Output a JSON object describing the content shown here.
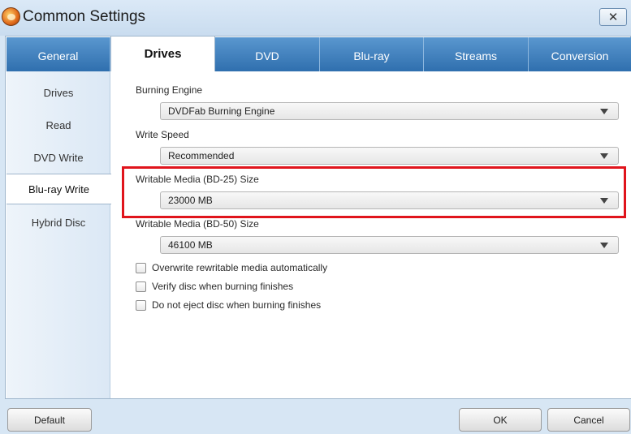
{
  "window": {
    "title": "Common Settings",
    "close_glyph": "✕"
  },
  "tabs": [
    "General",
    "Drives",
    "DVD",
    "Blu-ray",
    "Streams",
    "Conversion"
  ],
  "active_tab": "Drives",
  "nav": [
    "Drives",
    "Read",
    "DVD Write",
    "Blu-ray Write",
    "Hybrid Disc"
  ],
  "active_nav": "Blu-ray Write",
  "settings": {
    "burning_engine": {
      "label": "Burning Engine",
      "value": "DVDFab Burning Engine"
    },
    "write_speed": {
      "label": "Write Speed",
      "value": "Recommended"
    },
    "bd25_size": {
      "label": "Writable Media (BD-25) Size",
      "value": "23000 MB"
    },
    "bd50_size": {
      "label": "Writable Media (BD-50) Size",
      "value": "46100 MB"
    }
  },
  "checkboxes": [
    {
      "label": "Overwrite rewritable media automatically",
      "checked": false
    },
    {
      "label": "Verify disc when burning finishes",
      "checked": false
    },
    {
      "label": "Do not eject disc when burning finishes",
      "checked": false
    }
  ],
  "buttons": {
    "default": "Default",
    "ok": "OK",
    "cancel": "Cancel"
  },
  "colors": {
    "highlight": "#e0141c",
    "tabbar": "#2f6fae"
  },
  "icons": {
    "app": "dvdfab-app-icon",
    "close": "close-icon",
    "dropdown": "chevron-down-icon"
  }
}
